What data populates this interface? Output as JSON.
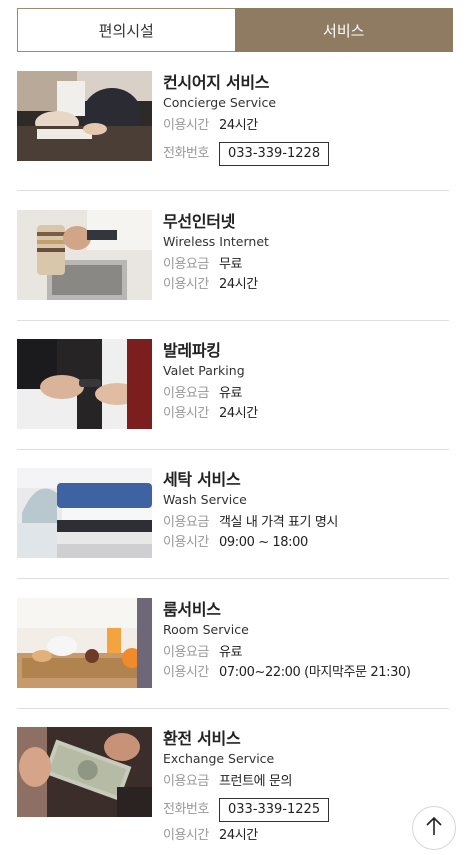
{
  "tabs": [
    {
      "label": "편의시설",
      "active": false
    },
    {
      "label": "서비스",
      "active": true
    }
  ],
  "services": [
    {
      "title_ko": "컨시어지 서비스",
      "title_en": "Concierge Service",
      "rows": [
        {
          "label": "이용시간",
          "value": "24시간"
        },
        {
          "label": "전화번호",
          "value": "033-339-1228",
          "phone": true
        }
      ]
    },
    {
      "title_ko": "무선인터넷",
      "title_en": "Wireless Internet",
      "rows": [
        {
          "label": "이용요금",
          "value": "무료"
        },
        {
          "label": "이용시간",
          "value": "24시간"
        }
      ]
    },
    {
      "title_ko": "발레파킹",
      "title_en": "Valet Parking",
      "rows": [
        {
          "label": "이용요금",
          "value": "유료"
        },
        {
          "label": "이용시간",
          "value": "24시간"
        }
      ]
    },
    {
      "title_ko": "세탁 서비스",
      "title_en": "Wash Service",
      "rows": [
        {
          "label": "이용요금",
          "value": "객실 내 가격 표기 명시"
        },
        {
          "label": "이용시간",
          "value": "09:00 ~ 18:00"
        }
      ]
    },
    {
      "title_ko": "룸서비스",
      "title_en": "Room Service",
      "rows": [
        {
          "label": "이용요금",
          "value": "유료"
        },
        {
          "label": "이용시간",
          "value": "07:00~22:00 (마지막주문 21:30)"
        }
      ]
    },
    {
      "title_ko": "환전 서비스",
      "title_en": "Exchange Service",
      "rows": [
        {
          "label": "이용요금",
          "value": "프런트에 문의"
        },
        {
          "label": "전화번호",
          "value": "033-339-1225",
          "phone": true
        },
        {
          "label": "이용시간",
          "value": "24시간"
        }
      ]
    }
  ],
  "icons": {
    "to_top": "arrow-up-icon"
  },
  "colors": {
    "accent": "#8f7b62",
    "divider": "#dedede",
    "label": "#999999"
  }
}
